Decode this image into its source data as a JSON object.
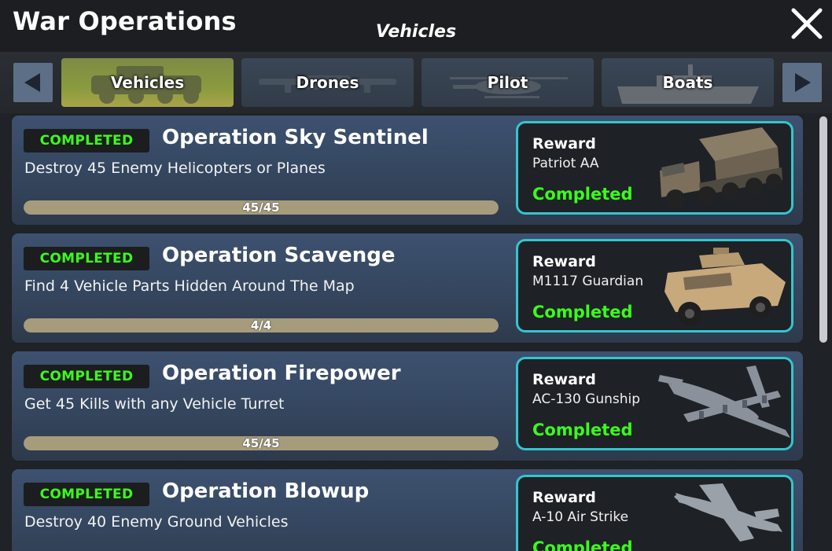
{
  "header": {
    "title": "War Operations",
    "section": "Vehicles",
    "close_icon": "close-icon"
  },
  "tabs": [
    {
      "label": "Vehicles",
      "icon": "armored-vehicle-silhouette",
      "active": true
    },
    {
      "label": "Drones",
      "icon": "drone-silhouette",
      "active": false
    },
    {
      "label": "Pilot",
      "icon": "helicopter-silhouette",
      "active": false
    },
    {
      "label": "Boats",
      "icon": "boat-silhouette",
      "active": false
    }
  ],
  "nav": {
    "prev_icon": "arrow-left-icon",
    "next_icon": "arrow-right-icon"
  },
  "operations": [
    {
      "status": "COMPLETED",
      "title": "Operation Sky Sentinel",
      "description": "Destroy 45 Enemy Helicopters or Planes",
      "progress_text": "45/45",
      "progress": 1.0,
      "reward": {
        "label": "Reward",
        "item": "Patriot AA",
        "status": "Completed",
        "image": "patriot-aa-truck"
      }
    },
    {
      "status": "COMPLETED",
      "title": "Operation Scavenge",
      "description": "Find 4 Vehicle Parts Hidden Around The Map",
      "progress_text": "4/4",
      "progress": 1.0,
      "reward": {
        "label": "Reward",
        "item": "M1117 Guardian",
        "status": "Completed",
        "image": "m1117-armored-car"
      }
    },
    {
      "status": "COMPLETED",
      "title": "Operation Firepower",
      "description": "Get 45 Kills with any Vehicle Turret",
      "progress_text": "45/45",
      "progress": 1.0,
      "reward": {
        "label": "Reward",
        "item": "AC-130 Gunship",
        "status": "Completed",
        "image": "ac130-gunship"
      }
    },
    {
      "status": "COMPLETED",
      "title": "Operation Blowup",
      "description": "Destroy 40 Enemy Ground Vehicles",
      "progress_text": "",
      "progress": 1.0,
      "reward": {
        "label": "Reward",
        "item": "A-10 Air Strike",
        "status": "Completed",
        "image": "a10-jet"
      }
    }
  ],
  "colors": {
    "completed_green": "#39ff1a",
    "reward_border": "#33c6cc",
    "progress_fill": "#a69c7c",
    "card_blue": "#3d5170",
    "active_tab": "#8a9a3e"
  }
}
